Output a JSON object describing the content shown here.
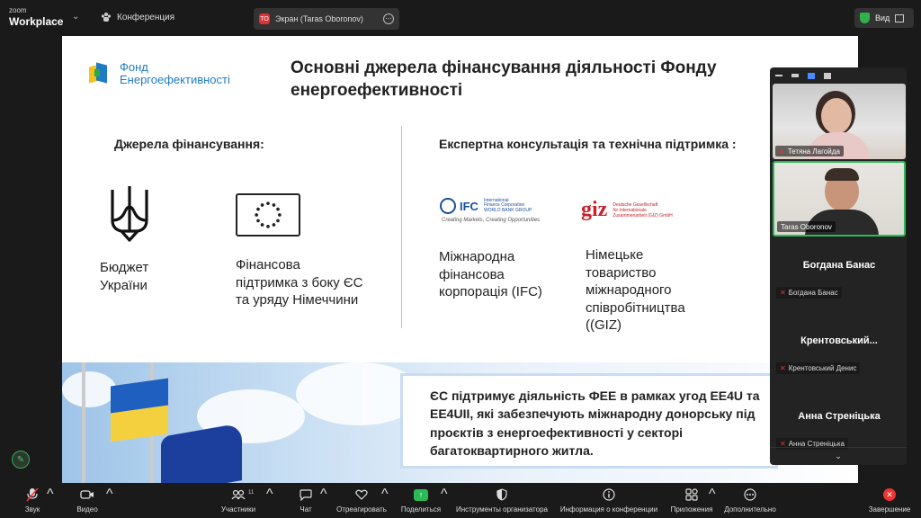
{
  "topbar": {
    "brand_top": "zoom",
    "brand_bottom": "Workplace",
    "meeting_label": "Конференция",
    "share_badge": "TO",
    "share_label": "Экран (Taras Oboronov)",
    "view_label": "Вид"
  },
  "slide": {
    "logo_line1": "Фонд",
    "logo_line2": "Енергоефективності",
    "title": "Основні джерела фінансування діяльності Фонду енергоефективності",
    "left_heading": "Джерела фінансування:",
    "right_heading": "Експертна консультація та технічна підтримка :",
    "cap_budget": "Бюджет\nУкраїни",
    "cap_eu": "Фінансова\nпідтримка з боку ЄС\nта уряду Німеччини",
    "ifc_name": "IFC",
    "ifc_sub": "International\nFinance Corporation\nWORLD BANK GROUP",
    "ifc_tagline": "Creating Markets, Creating Opportunities",
    "giz_logo": "giz",
    "giz_sub": "Deutsche Gesellschaft\nfür Internationale\nZusammenarbeit (GIZ) GmbH",
    "cap_ifc": "Міжнародна\nфінансова\nкорпорація (IFC)",
    "cap_giz": "Німецьке\nтовариство\nміжнародного\nспівробітництва\n((GIZ)",
    "callout": "ЄС підтримує діяльність ФЕЕ в рамках угод EE4U та\nEE4UII, які забезпечують міжнародну донорську під\nпроєктів з енергоефективності у секторі\nбагатоквартирного житла."
  },
  "participants": [
    {
      "tile_name": "",
      "tag": "Тетяна Лагойда",
      "muted": true
    },
    {
      "tile_name": "",
      "tag": "Taras Oboronov",
      "muted": false
    },
    {
      "tile_name": "Богдана Банас",
      "tag": "Богдана Банас",
      "muted": true
    },
    {
      "tile_name": "Крентовський...",
      "tag": "Крентовський Денис",
      "muted": true
    },
    {
      "tile_name": "Анна Стреніцька",
      "tag": "Анна Стреніцька",
      "muted": true
    }
  ],
  "toolbar": {
    "audio": "Звук",
    "video": "Видео",
    "participants": "Участники",
    "participants_count": "11",
    "chat": "Чат",
    "react": "Отреагировать",
    "share": "Поделиться",
    "host_tools": "Инструменты организатора",
    "info": "Информация о конференции",
    "apps": "Приложения",
    "more": "Дополнительно",
    "end": "Завершение"
  },
  "colors": {
    "accent_green": "#2bbb56",
    "end_red": "#e33333",
    "ukraine_blue": "#1f5fbf",
    "ukraine_yellow": "#f4d03f",
    "eu_blue": "#1c3e9c"
  }
}
